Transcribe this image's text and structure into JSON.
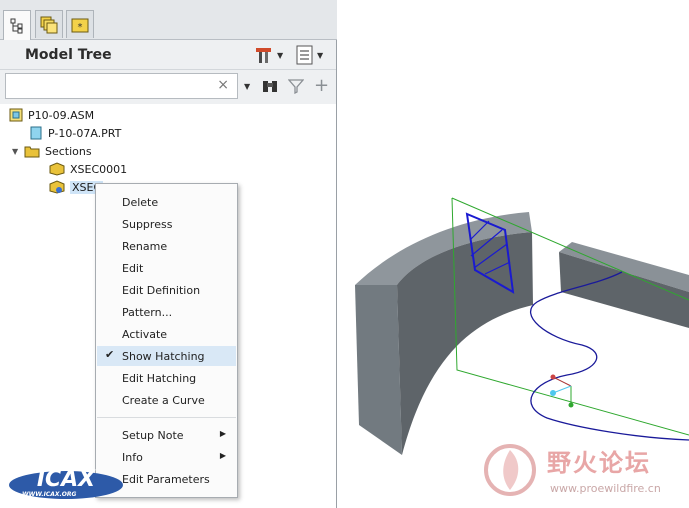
{
  "tabs": [
    {
      "icon": "model-tree-icon"
    },
    {
      "icon": "layers-icon"
    },
    {
      "icon": "favorites-folder-icon"
    }
  ],
  "panel": {
    "title": "Model Tree",
    "search": {
      "value": "",
      "placeholder": "",
      "clear_glyph": "×"
    }
  },
  "tree": [
    {
      "label": "P10-09.ASM",
      "icon": "assembly-icon"
    },
    {
      "label": "P-10-07A.PRT",
      "icon": "part-icon"
    },
    {
      "label": "Sections",
      "icon": "sections-folder-icon",
      "expander": "▼"
    },
    {
      "label": "XSEC0001",
      "icon": "section-icon"
    },
    {
      "label": "XSEC",
      "icon": "section-icon",
      "selected": true
    }
  ],
  "context_menu": {
    "items": [
      {
        "label": "Delete"
      },
      {
        "label": "Suppress"
      },
      {
        "label": "Rename"
      },
      {
        "label": "Edit"
      },
      {
        "label": "Edit Definition"
      },
      {
        "label": "Pattern..."
      },
      {
        "label": "Activate"
      },
      {
        "label": "Show Hatching",
        "checked": true,
        "highlighted": true
      },
      {
        "label": "Edit Hatching"
      },
      {
        "label": "Create a Curve"
      },
      {
        "label": "Setup Note",
        "submenu": true
      },
      {
        "label": "Info",
        "submenu": true
      },
      {
        "label": "Edit Parameters"
      }
    ],
    "check_glyph": "✔",
    "submenu_glyph": "▶"
  },
  "colors": {
    "solid_top": "#8f969c",
    "solid_front": "#6e757b",
    "solid_dark": "#555b60",
    "section_plane": "#2fa82f",
    "hatch": "#1a1ad0",
    "curve": "#1a1a9a"
  },
  "watermark": {
    "logo_text": "ICAX",
    "logo_caption": "WWW.ICAX.ORG",
    "forum_name": "野火论坛",
    "forum_url": "www.proewildfire.cn"
  }
}
